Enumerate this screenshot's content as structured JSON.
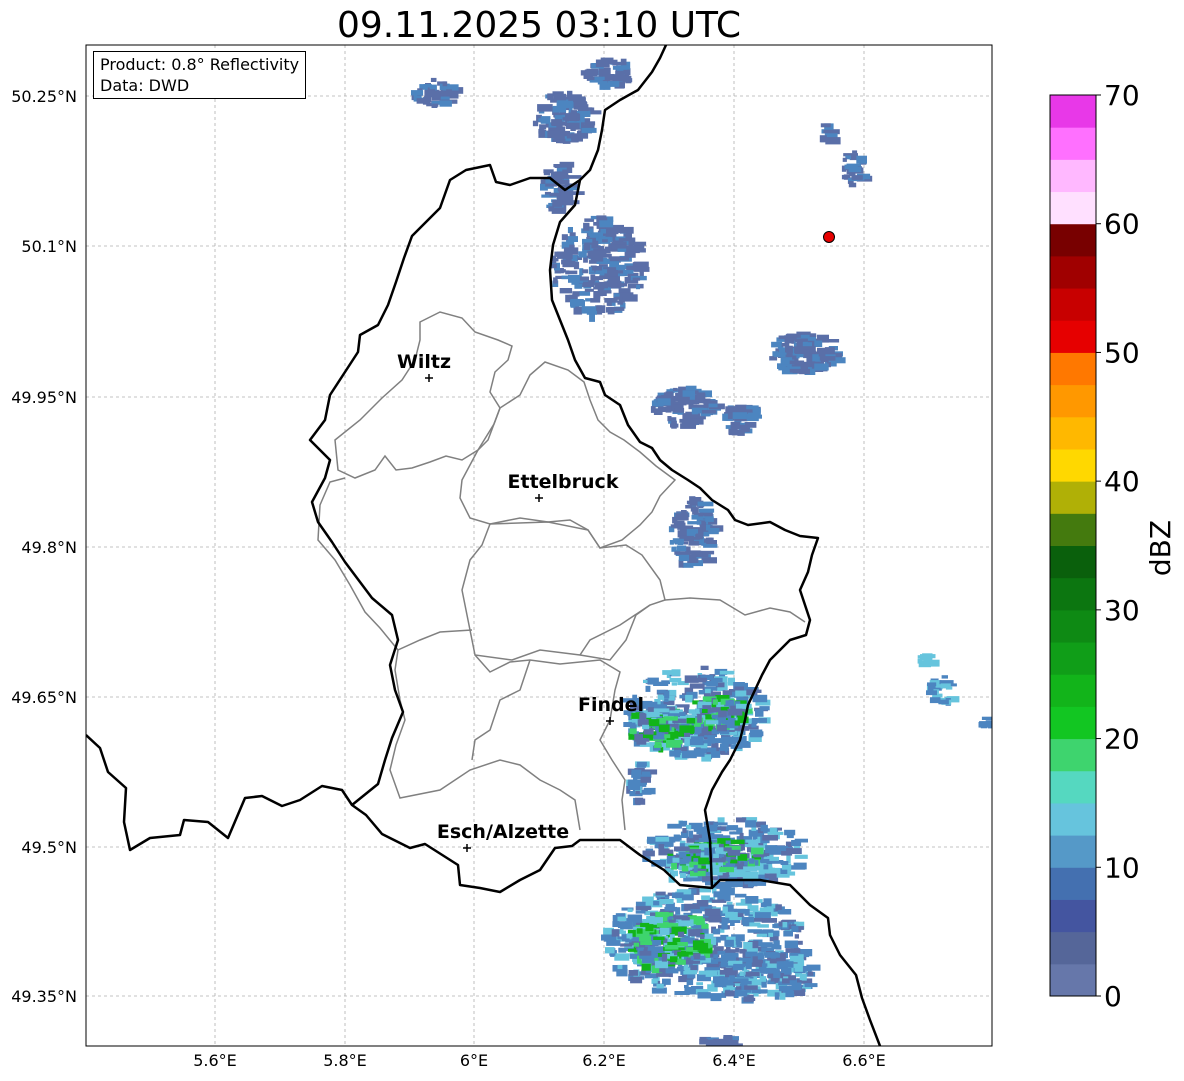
{
  "title": "09.11.2025 03:10 UTC",
  "info": {
    "product": "Product: 0.8° Reflectivity",
    "source": "Data: DWD"
  },
  "axes": {
    "lat_ticks": [
      "50.25°N",
      "50.1°N",
      "49.95°N",
      "49.8°N",
      "49.65°N",
      "49.5°N",
      "49.35°N"
    ],
    "lon_ticks": [
      "5.6°E",
      "5.8°E",
      "6°E",
      "6.2°E",
      "6.4°E",
      "6.6°E"
    ]
  },
  "places": [
    {
      "name": "Wiltz"
    },
    {
      "name": "Ettelbruck"
    },
    {
      "name": "Findel"
    },
    {
      "name": "Esch/Alzette"
    }
  ],
  "colorbar": {
    "label": "dBZ",
    "ticks": [
      "0",
      "10",
      "20",
      "30",
      "40",
      "50",
      "60",
      "70"
    ],
    "colors": [
      "#6677aa",
      "#556699",
      "#4455a0",
      "#4470b0",
      "#5599c8",
      "#66c4dd",
      "#55d8c0",
      "#3ed46e",
      "#12c622",
      "#12b41a",
      "#109e18",
      "#0e8a14",
      "#0c7610",
      "#0a600c",
      "#447a0e",
      "#b0b006",
      "#ffd800",
      "#ffb800",
      "#ff9800",
      "#ff7800",
      "#e60000",
      "#c80000",
      "#a00000",
      "#780000",
      "#ffe0ff",
      "#ffb8ff",
      "#ff70ff",
      "#e838e8"
    ]
  },
  "echo_colors": {
    "weak": "#5a6fa8",
    "moderate": "#4c85c0",
    "light": "#66c4dd",
    "medium": "#3ed46e",
    "strong": "#12b41a"
  },
  "marker_color": "#e60000"
}
